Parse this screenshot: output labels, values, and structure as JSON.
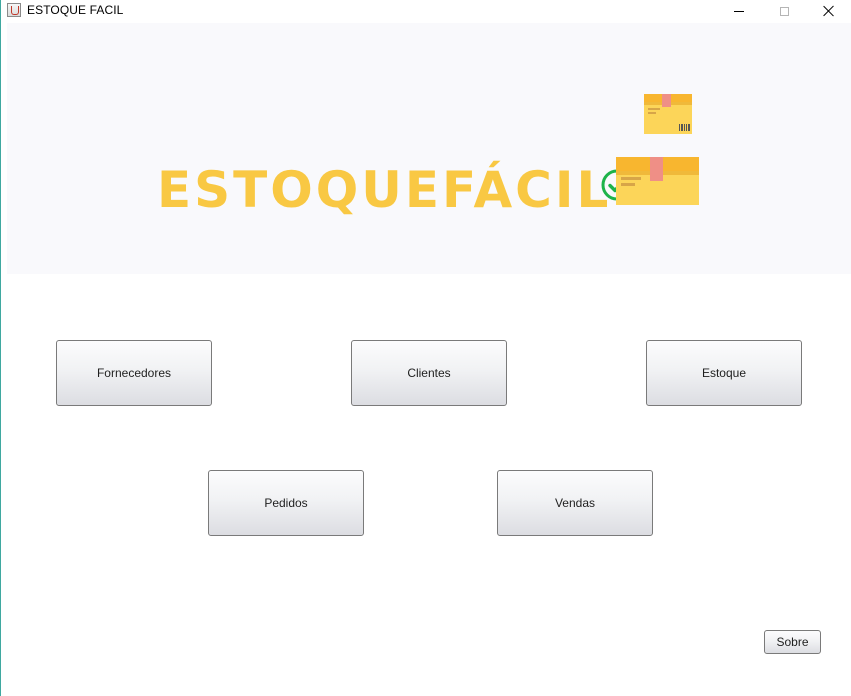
{
  "window": {
    "title": "ESTOQUE FACIL",
    "icon": "java-cup-icon"
  },
  "banner": {
    "logo_text": "ESTOQUEFÁCIL",
    "logo_color": "#f9c843",
    "check_icon": "check-circle-icon",
    "check_color": "#1db34a",
    "boxes_icon": "cardboard-boxes-icon"
  },
  "menu": {
    "fornecedores": "Fornecedores",
    "clientes": "Clientes",
    "estoque": "Estoque",
    "pedidos": "Pedidos",
    "vendas": "Vendas"
  },
  "footer": {
    "sobre": "Sobre"
  }
}
